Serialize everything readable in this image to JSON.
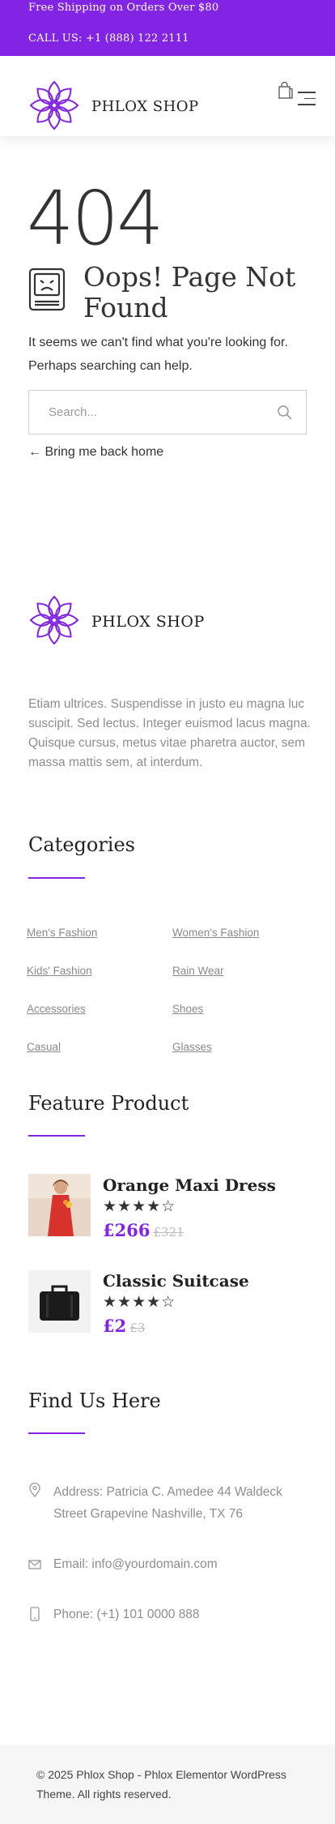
{
  "topbar": {
    "shipping": "Free Shipping on Orders Over $80",
    "phone": "CALL US: +1 (888) 122 2111"
  },
  "header": {
    "brand": "PHLOX SHOP",
    "cart_icon": "shopping-bag-icon",
    "menu_icon": "hamburger-menu-icon"
  },
  "error": {
    "code": "404",
    "icon": "sad-computer-icon",
    "title": "Oops! Page Not Found",
    "message": "It seems we can't find what you're looking for. Perhaps searching can help.",
    "search_placeholder": "Search...",
    "back_home": "← Bring me back home"
  },
  "footer": {
    "brand": "PHLOX SHOP",
    "about": "Etiam ultrices. Suspendisse in justo eu magna luc suscipit. Sed lectus. Integer euismod lacus magna. Quisque cursus, metus vitae pharetra auctor, sem massa mattis sem, at interdum.",
    "categories_title": "Categories",
    "categories": [
      "Men's Fashion",
      "Women's Fashion",
      "Kids' Fashion",
      "Rain Wear",
      "Accessories",
      "Shoes",
      "Casual",
      "Glasses"
    ],
    "feature_title": "Feature Product",
    "products": [
      {
        "name": "Orange Maxi Dress",
        "stars": "★★★★☆",
        "rating": 4,
        "price": "£266",
        "old_price": "£321"
      },
      {
        "name": "Classic Suitcase",
        "stars": "★★★★☆",
        "rating": 4,
        "price": "£2",
        "old_price": "£3"
      }
    ],
    "find_title": "Find Us Here",
    "address": "Address: Patricia C. Amedee 44 Waldeck Street Grapevine Nashville, TX 76",
    "email": "Email: info@yourdomain.com",
    "phone": "Phone: (+1) 101 0000 888",
    "copyright": "© 2025 Phlox Shop - Phlox Elementor WordPress Theme. All rights reserved."
  },
  "colors": {
    "accent": "#8224e3",
    "topbar_bg": "#8224e3",
    "copyright_bg": "#f6f6f6"
  }
}
